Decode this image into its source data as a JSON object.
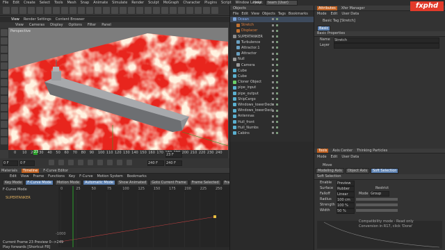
{
  "menu": [
    "File",
    "Edit",
    "Create",
    "Select",
    "Tools",
    "Mesh",
    "Snap",
    "Animate",
    "Simulate",
    "Render",
    "Sculpt",
    "MoGraph",
    "Character",
    "Plugins",
    "Script",
    "Window",
    "Help"
  ],
  "layout": {
    "label": "Layout:",
    "value": "team (User)"
  },
  "viewport": {
    "tabs": [
      "View",
      "Render Settings",
      "Content Browser"
    ],
    "menu": [
      "View",
      "Cameras",
      "Display",
      "Options",
      "Filter",
      "Panel"
    ],
    "label": "Perspective"
  },
  "timeline": {
    "ticks": [
      "0",
      "10",
      "20",
      "30",
      "40",
      "50",
      "60",
      "70",
      "80",
      "90",
      "100",
      "110",
      "120",
      "130",
      "140",
      "150",
      "160",
      "170",
      "180",
      "190",
      "200",
      "210",
      "220",
      "230",
      "240"
    ],
    "current": "23",
    "frame_field": "23 F",
    "start": "0 F",
    "end_min": "0 F",
    "end_max": "240 F",
    "end_field": "240 F"
  },
  "bottom": {
    "tabs": [
      "Materials",
      "Timeline",
      "F-Curve Editor"
    ],
    "menu": [
      "Edit",
      "View",
      "Frame",
      "Functions",
      "Key",
      "F-Curve",
      "Motion System",
      "Bookmarks"
    ],
    "modes": [
      "Key Mode",
      "F-Curve Mode",
      "Motion Mode",
      "Automatic Mode",
      "Show Animated",
      "Goto Current Frame",
      "Frame Selected",
      "Frame All"
    ],
    "title": "F-Curve Mode",
    "track": "SUPERTANKER",
    "ticks": [
      "0",
      "25",
      "50",
      "75",
      "100",
      "125",
      "150",
      "175",
      "200",
      "225",
      "250"
    ],
    "value_label": "-1000",
    "status1": "Current Frame  23  Preview  0-->249",
    "status2": "Play forwards [Shortcut F8]"
  },
  "objects": {
    "tabs": [
      "Objects"
    ],
    "menu": [
      "File",
      "Edit",
      "View",
      "Objects",
      "Tags",
      "Bookmarks"
    ],
    "rows": [
      {
        "name": "Ocean",
        "color": "#7aa2d6",
        "indent": 0,
        "hl": true
      },
      {
        "name": "Stretch",
        "color": "#c07030",
        "indent": 1
      },
      {
        "name": "Displacer",
        "color": "#c07030",
        "indent": 1
      },
      {
        "name": "SUPERTANKER",
        "color": "#8a8a8a",
        "indent": 0
      },
      {
        "name": "Turbulence",
        "color": "#6aa0c0",
        "indent": 1
      },
      {
        "name": "Attractor.1",
        "color": "#6aa0c0",
        "indent": 1
      },
      {
        "name": "Attractor",
        "color": "#6aa0c0",
        "indent": 1
      },
      {
        "name": "Null",
        "color": "#9a9a9a",
        "indent": 0
      },
      {
        "name": "Camera",
        "color": "#9a9a9a",
        "indent": 1
      },
      {
        "name": "Cube",
        "color": "#5ab0d0",
        "indent": 0
      },
      {
        "name": "Cube",
        "color": "#5ab0d0",
        "indent": 0
      },
      {
        "name": "Cloner Object",
        "color": "#6ad06a",
        "indent": 0
      },
      {
        "name": "pipe_input",
        "color": "#5ab0d0",
        "indent": 0
      },
      {
        "name": "pipe_output",
        "color": "#5ab0d0",
        "indent": 0
      },
      {
        "name": "ShipCargo",
        "color": "#5ab0d0",
        "indent": 0
      },
      {
        "name": "Windows_lowerDeck",
        "color": "#5ab0d0",
        "indent": 0
      },
      {
        "name": "Windows_lowerDeck",
        "color": "#5ab0d0",
        "indent": 0
      },
      {
        "name": "Antennas",
        "color": "#5ab0d0",
        "indent": 0
      },
      {
        "name": "Hull_front",
        "color": "#5ab0d0",
        "indent": 0
      },
      {
        "name": "Hull_Numbs",
        "color": "#5ab0d0",
        "indent": 0
      },
      {
        "name": "Cabins",
        "color": "#5ab0d0",
        "indent": 0
      }
    ]
  },
  "attributes": {
    "top_tabs": [
      "Attributes",
      "Xfer Manager"
    ],
    "menu": [
      "Mode",
      "Edit",
      "User Data"
    ],
    "object_title": "Basic Tag [Stretch]",
    "subtab": "Basic",
    "section": "Basic Properties",
    "fields": [
      {
        "label": "Name",
        "value": "Stretch"
      },
      {
        "label": "Layer",
        "value": ""
      }
    ]
  },
  "tools": {
    "tabs": [
      "Tools",
      "Axis Center",
      "Thinking Particles"
    ],
    "menu": [
      "Mode",
      "Edit",
      "User Data"
    ],
    "title": "Move",
    "subtabs": [
      "Modeling Axis",
      "Object Axis",
      "Soft Selection"
    ],
    "section": "Soft Selection",
    "rows": [
      {
        "label": "Enable",
        "value": "Preview"
      },
      {
        "label": "Surface",
        "value": "Rubber"
      },
      {
        "label": "Falloff",
        "value": "Linear"
      },
      {
        "label": "Radius",
        "value": "100 cm"
      },
      {
        "label": "Strength",
        "value": "100 %"
      },
      {
        "label": "Width",
        "value": "50 %"
      }
    ],
    "restrict": "Restrict",
    "mode_label": "Mode",
    "mode_value": "Group",
    "note1": "Compatibility mode - Read only",
    "note2": "Conversion in R17, click 'Done'"
  },
  "logo": "fxphd",
  "colors": {
    "accent": "#5a7fb0",
    "logo": "#e23a2a"
  }
}
